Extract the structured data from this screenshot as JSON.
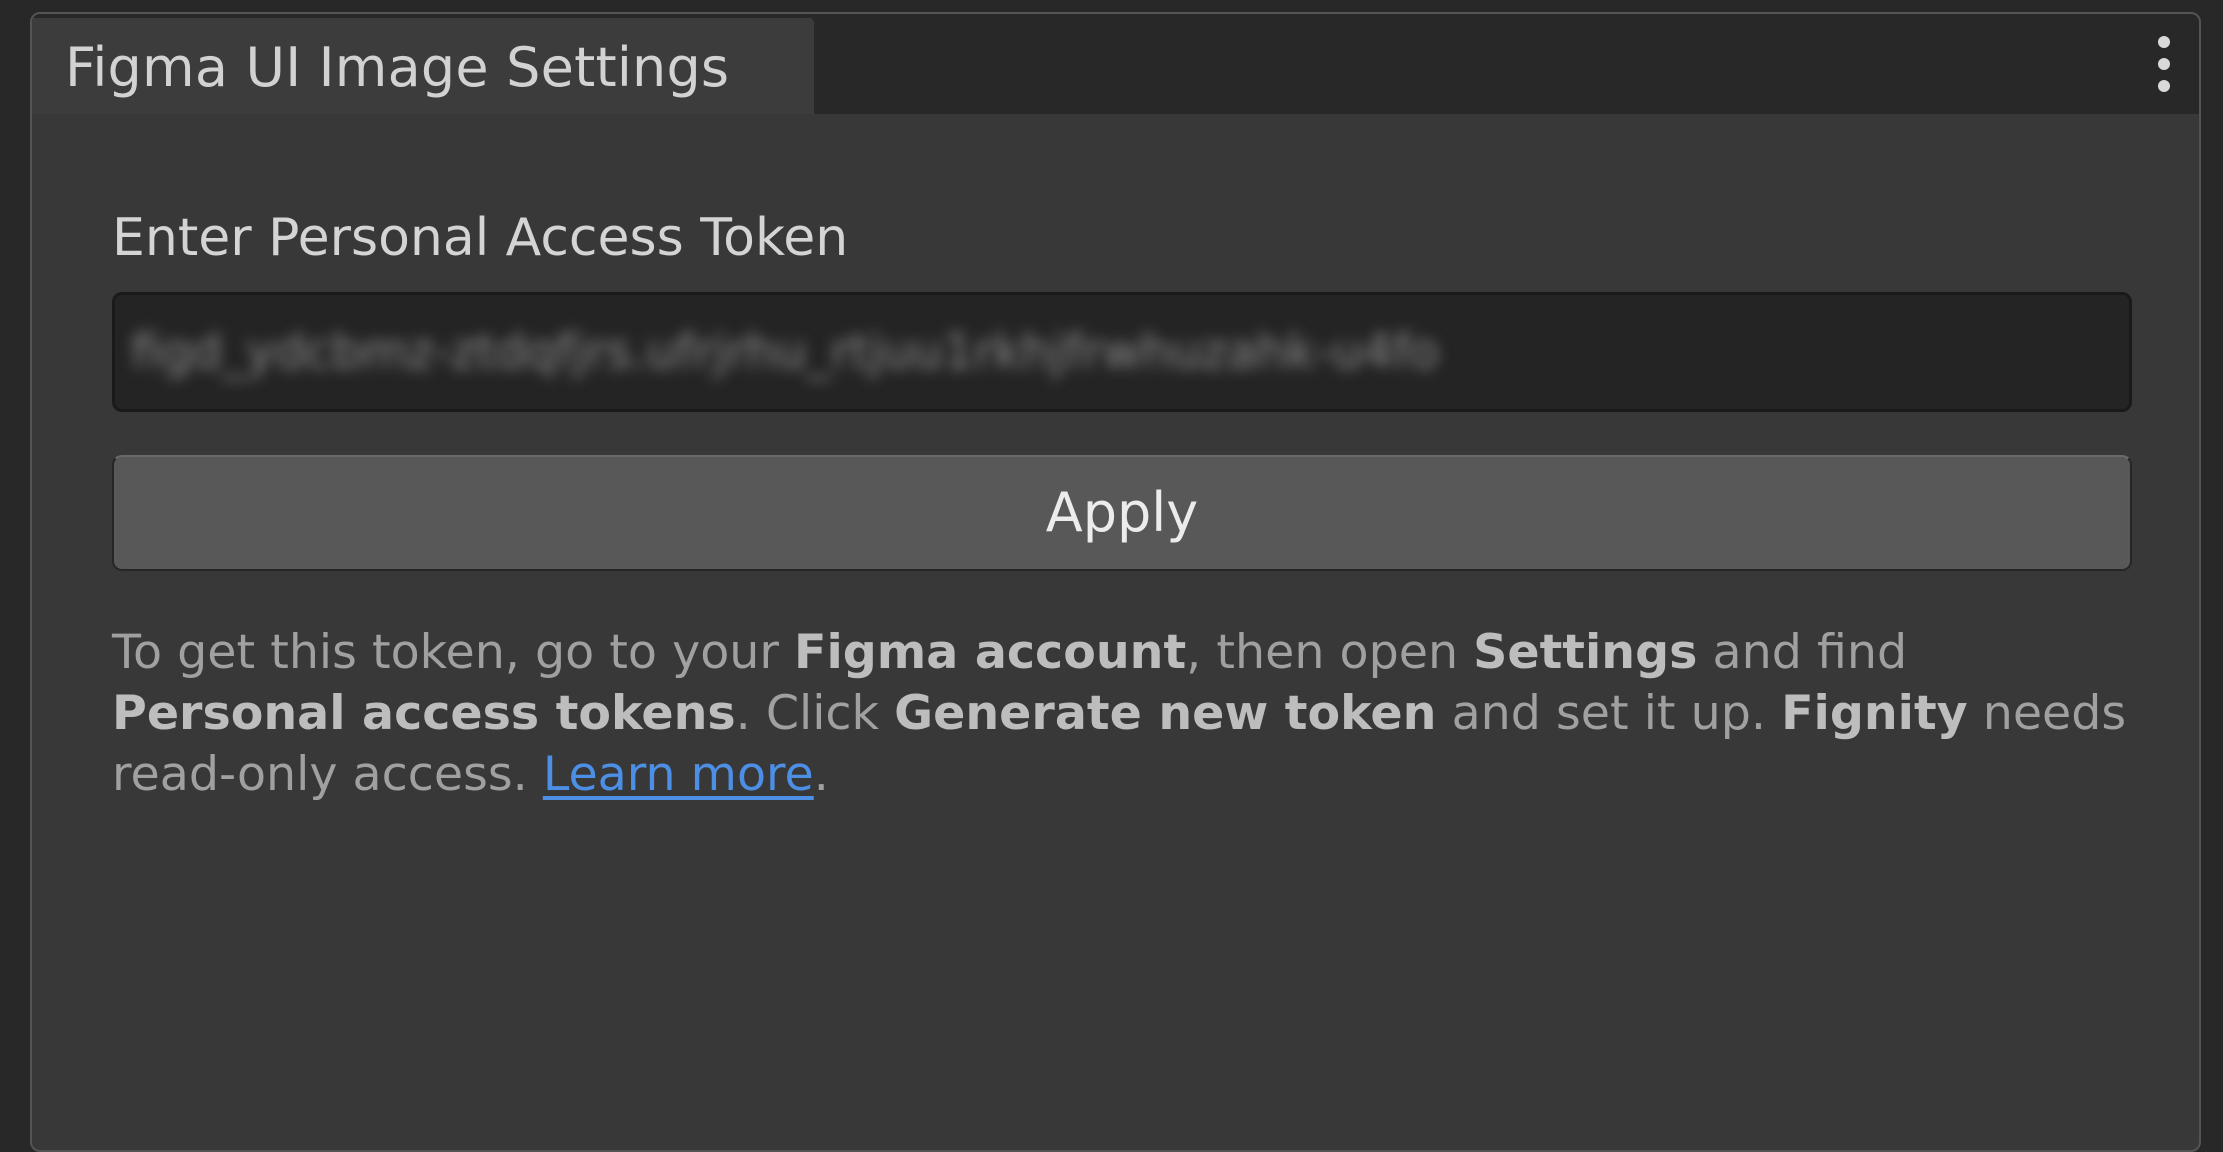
{
  "window": {
    "tab_title": "Figma UI Image Settings",
    "menu_icon": "kebab-menu-icon"
  },
  "form": {
    "label": "Enter Personal Access Token",
    "token_value": "figd_ydcbmz-ztdqfjrs.ufrjrhu_rtjuu1rkhjfrwhuzahk-u4fo",
    "apply_label": "Apply"
  },
  "help": {
    "t1": "To get this token, go to your ",
    "b1": "Figma account",
    "t2": ", then open ",
    "b2": "Settings",
    "t3": " and find ",
    "b3": "Personal access tokens",
    "t4": ". Click ",
    "b4": "Generate new token",
    "t5": " and set it up. ",
    "b5": "Fignity",
    "t6": " needs read-only access. ",
    "link": "Learn more",
    "t7": "."
  },
  "colors": {
    "background": "#282828",
    "panel": "#383838",
    "button": "#585858",
    "link": "#4c8fe4"
  }
}
